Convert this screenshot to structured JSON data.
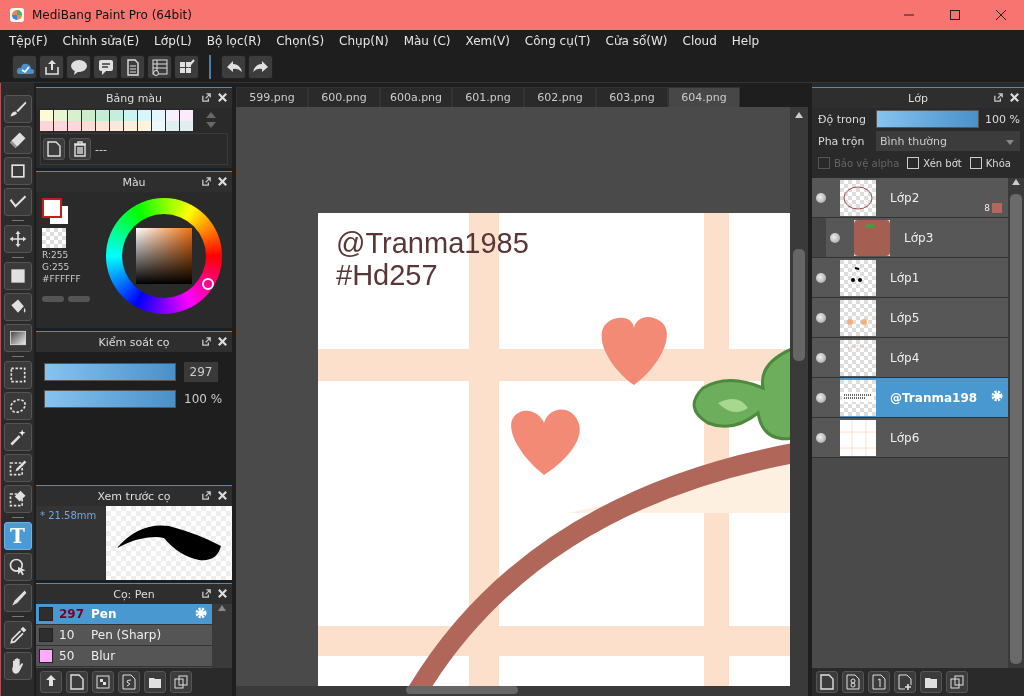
{
  "window": {
    "title": "MediBang Paint Pro (64bit)"
  },
  "menu": [
    "Tệp(F)",
    "Chỉnh sửa(E)",
    "Lớp(L)",
    "Bộ lọc(R)",
    "Chọn(S)",
    "Chụp(N)",
    "Màu (C)",
    "Xem(V)",
    "Công cụ(T)",
    "Cửa sổ(W)",
    "Cloud",
    "Help"
  ],
  "tool_groups": [
    [
      {
        "kind": "brush",
        "selected": false
      },
      {
        "kind": "eraser",
        "selected": false
      },
      {
        "kind": "rectangle",
        "selected": false
      },
      {
        "kind": "polyline",
        "selected": false
      }
    ],
    [
      {
        "kind": "move",
        "selected": false
      }
    ],
    [
      {
        "kind": "fill",
        "selected": false
      },
      {
        "kind": "bucket",
        "selected": false
      },
      {
        "kind": "gradient",
        "selected": false
      }
    ],
    [
      {
        "kind": "select",
        "selected": false
      },
      {
        "kind": "lasso",
        "selected": false
      },
      {
        "kind": "wand",
        "selected": false
      },
      {
        "kind": "select_pen",
        "selected": false
      },
      {
        "kind": "select_eraser",
        "selected": false
      }
    ],
    [
      {
        "kind": "text",
        "glyph": "T",
        "selected": true
      },
      {
        "kind": "operation",
        "selected": false
      },
      {
        "kind": "knife",
        "selected": false
      }
    ],
    [
      {
        "kind": "dropper",
        "selected": false
      },
      {
        "kind": "hand",
        "selected": false
      }
    ]
  ],
  "palette": {
    "title": "Bảng màu",
    "swatches": [
      {
        "color": "#fdfbd5"
      },
      {
        "color": "#e8f5d5"
      },
      {
        "color": "#d8f0d0"
      },
      {
        "color": "#cdeccd"
      },
      {
        "color": "#c5ecd5"
      },
      {
        "color": "#c5eedc"
      },
      {
        "color": "#cdf3f0"
      },
      {
        "color": "#d8f6f9"
      },
      {
        "color": "#e5f6fc"
      },
      {
        "color": "#f6f0fc"
      },
      {
        "color": "#faeafc"
      },
      {
        "color": "#fcd5d8"
      },
      {
        "color": "#fcd8dc"
      },
      {
        "color": "#fcd8d8"
      },
      {
        "color": "#fcdcd5"
      },
      {
        "color": "#fce5d8"
      },
      {
        "color": "#fce8dc"
      },
      {
        "color": "#fceedc"
      },
      {
        "color": "#fcf5dc"
      },
      {
        "color": "#eef8f8"
      },
      {
        "color": "#e0f0f0"
      },
      {
        "color": "#e0eef0"
      }
    ],
    "label": "---"
  },
  "color_panel": {
    "title": "Màu",
    "r": "R:255",
    "g": "G:255",
    "hex": "#FFFFFF"
  },
  "brush_control": {
    "title": "Kiểm soát cọ",
    "size": {
      "value": "297",
      "level": 1
    },
    "opacity": {
      "value": "100 %",
      "level": 1
    }
  },
  "brush_preview": {
    "title": "Xem trước cọ",
    "size": "* 21.58mm"
  },
  "brushes": {
    "title": "Cọ: Pen",
    "items": [
      {
        "size": "297",
        "name": "Pen",
        "color": "#2e2e2e",
        "selected": true
      },
      {
        "size": "10",
        "name": "Pen (Sharp)",
        "color": "#2e2e2e",
        "selected": false
      },
      {
        "size": "50",
        "name": "Blur",
        "color": "#ffaaff",
        "selected": false
      }
    ]
  },
  "tabs": [
    {
      "label": "599.png",
      "selected": false
    },
    {
      "label": "600.png",
      "selected": false
    },
    {
      "label": "600a.png",
      "selected": false
    },
    {
      "label": "601.png",
      "selected": false
    },
    {
      "label": "602.png",
      "selected": false
    },
    {
      "label": "603.png",
      "selected": false
    },
    {
      "label": "604.png",
      "selected": true
    }
  ],
  "canvas": {
    "text_lines": [
      "@Tranma1985",
      "#Hd257"
    ]
  },
  "layers_panel": {
    "title": "Lớp",
    "opacity_label": "Độ trong",
    "opacity": {
      "value": "100 %",
      "level": 1
    },
    "blend_label": "Pha trộn",
    "blend": "Bình thường",
    "options": [
      {
        "label": "Bảo vệ alpha",
        "checked": false,
        "disabled": true
      },
      {
        "label": "Xén bớt",
        "checked": false,
        "disabled": false
      },
      {
        "label": "Khóa",
        "checked": false,
        "disabled": false
      }
    ],
    "layers": [
      {
        "name": "Lớp2",
        "selected": false,
        "clipped": false,
        "badge": "8",
        "color": "#b5665a"
      },
      {
        "name": "Lớp3",
        "selected": false,
        "clipped": true
      },
      {
        "name": "Lớp1",
        "selected": false,
        "clipped": false
      },
      {
        "name": "Lớp5",
        "selected": false,
        "clipped": false
      },
      {
        "name": "Lớp4",
        "selected": false,
        "clipped": false
      },
      {
        "name": "@Tranma198",
        "selected": true,
        "clipped": false
      },
      {
        "name": "Lớp6",
        "selected": false,
        "clipped": false
      }
    ]
  }
}
